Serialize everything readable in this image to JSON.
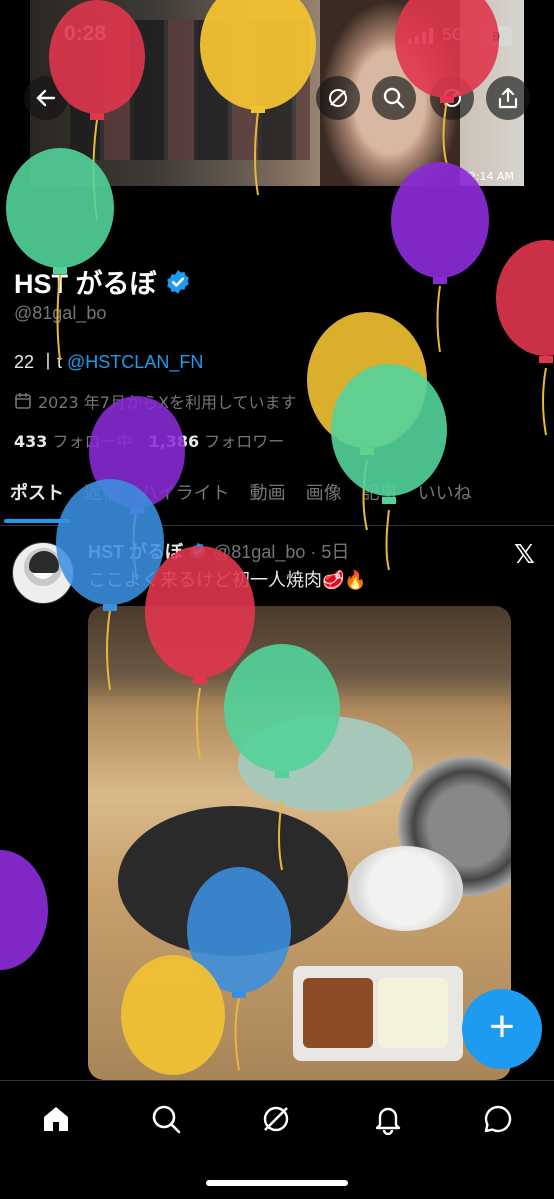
{
  "status_bar": {
    "time": "0:28",
    "network": "5G",
    "battery": "9"
  },
  "banner": {
    "timestamp": "02:14 AM"
  },
  "header": {
    "icons": [
      "back-arrow-icon",
      "grok-icon",
      "search-icon",
      "grok-icon",
      "share-icon"
    ]
  },
  "profile": {
    "name": "HST がるぼ",
    "handle": "@81gal_bo",
    "bio_prefix": "22 丨t ",
    "bio_link": "@HSTCLAN_FN",
    "joined": "2023 年7月からXを利用しています",
    "following_count": "433",
    "following_label": "フォロー中",
    "followers_count": "1,386",
    "followers_label": "フォロワー"
  },
  "tabs": [
    "ポスト",
    "返信",
    "ハイライト",
    "動画",
    "画像",
    "記事",
    "いいね"
  ],
  "post": {
    "author": "HST がるぼ",
    "meta": "@81gal_bo · 5日",
    "text": "ここよく来るけど初一人焼肉🥩🔥"
  },
  "fab": {
    "label": "+"
  },
  "colors": {
    "accent": "#1d9bf0",
    "background": "#000000",
    "muted": "#71767b"
  },
  "nav": [
    "home-icon",
    "search-icon",
    "grok-icon",
    "notifications-icon",
    "messages-icon"
  ]
}
